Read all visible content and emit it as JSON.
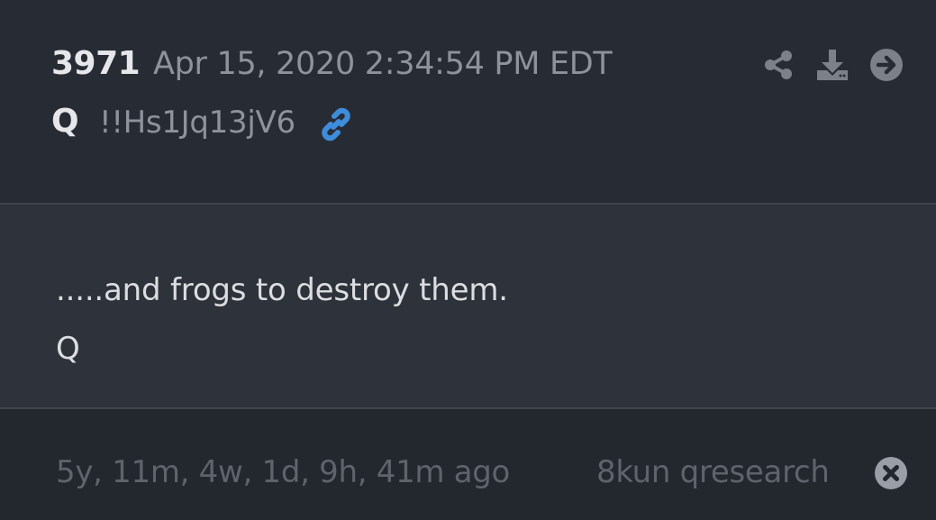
{
  "post": {
    "number": "3971",
    "date": "Apr 15, 2020 2:34:54 PM EDT",
    "author": "Q",
    "tripcode": "!!Hs1Jq13jV6",
    "body_lines": [
      ".....and frogs to destroy them.",
      "Q"
    ]
  },
  "actions": {
    "share_icon": "share-icon",
    "download_icon": "download-icon",
    "goto_icon": "arrow-circle-right-icon"
  },
  "footer": {
    "ago": "5y, 11m, 4w, 1d, 9h, 41m ago",
    "board": "8kun qresearch"
  },
  "colors": {
    "accent": "#3d8ddb",
    "background": "#282c35",
    "body_background": "#2e323a",
    "footer_background": "#23272e",
    "primary_text": "#e6e7ea",
    "muted_text": "#8e929b",
    "footer_text": "#5f636b"
  }
}
